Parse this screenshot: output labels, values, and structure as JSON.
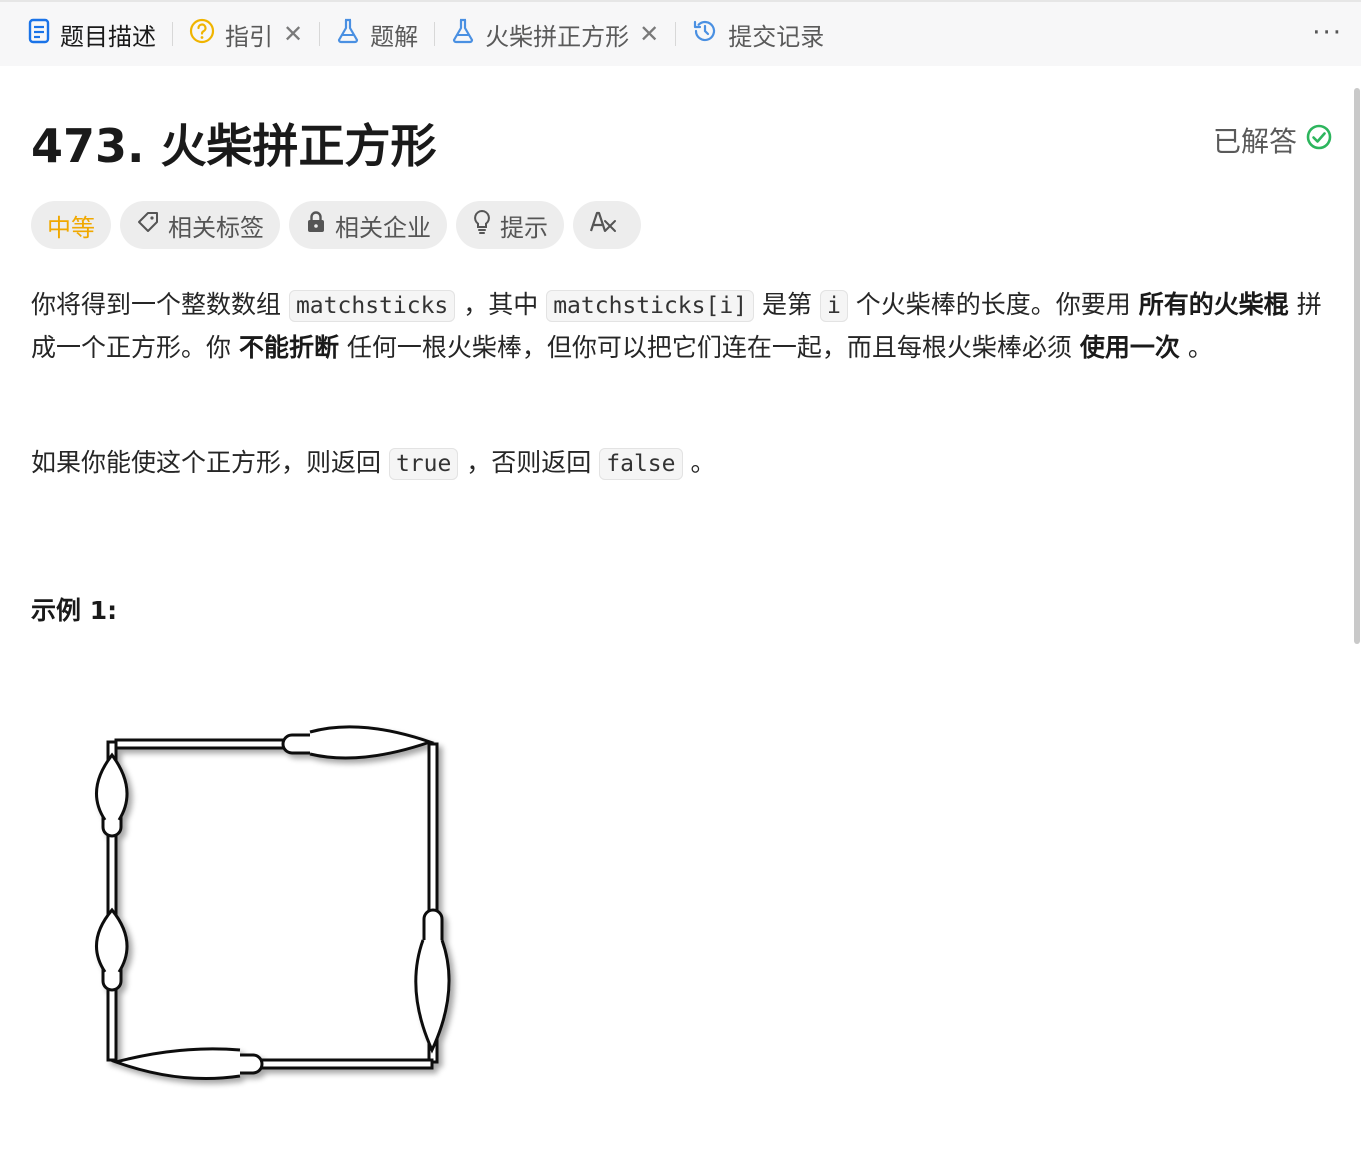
{
  "tabs": [
    {
      "label": "题目描述",
      "icon": "document-icon"
    },
    {
      "label": "指引",
      "icon": "help-circle-icon",
      "closable": true
    },
    {
      "label": "题解",
      "icon": "flask-icon"
    },
    {
      "label": "火柴拼正方形",
      "icon": "flask-icon",
      "closable": true
    },
    {
      "label": "提交记录",
      "icon": "history-icon"
    }
  ],
  "tab_close_glyph": "✕",
  "more_glyph": "···",
  "problem": {
    "title": "473. 火柴拼正方形",
    "status": "已解答",
    "difficulty": "中等",
    "tags": [
      "相关标签",
      "相关企业",
      "提示"
    ]
  },
  "description": {
    "p1": {
      "t1": "你将得到一个整数数组 ",
      "c1": "matchsticks",
      "t2": " ，其中 ",
      "c2": "matchsticks[i]",
      "t3": " 是第 ",
      "c3": "i",
      "t4": " 个火柴棒的长度。你要用 ",
      "b1": "所有的火柴棍",
      "t5": " 拼成一个正方形。你 ",
      "b2": "不能折断",
      "t6": " 任何一根火柴棒，但你可以把它们连在一起，而且每根火柴棒必须 ",
      "b3": "使用一次",
      "t7": " 。"
    },
    "p2": {
      "t1": "如果你能使这个正方形，则返回 ",
      "c1": "true",
      "t2": " ，否则返回 ",
      "c2": "false",
      "t3": " 。"
    }
  },
  "example": {
    "heading": "示例 1:"
  },
  "colors": {
    "accent": "#1a73e8",
    "success": "#2db55d",
    "difficulty_medium": "#f0a800"
  }
}
